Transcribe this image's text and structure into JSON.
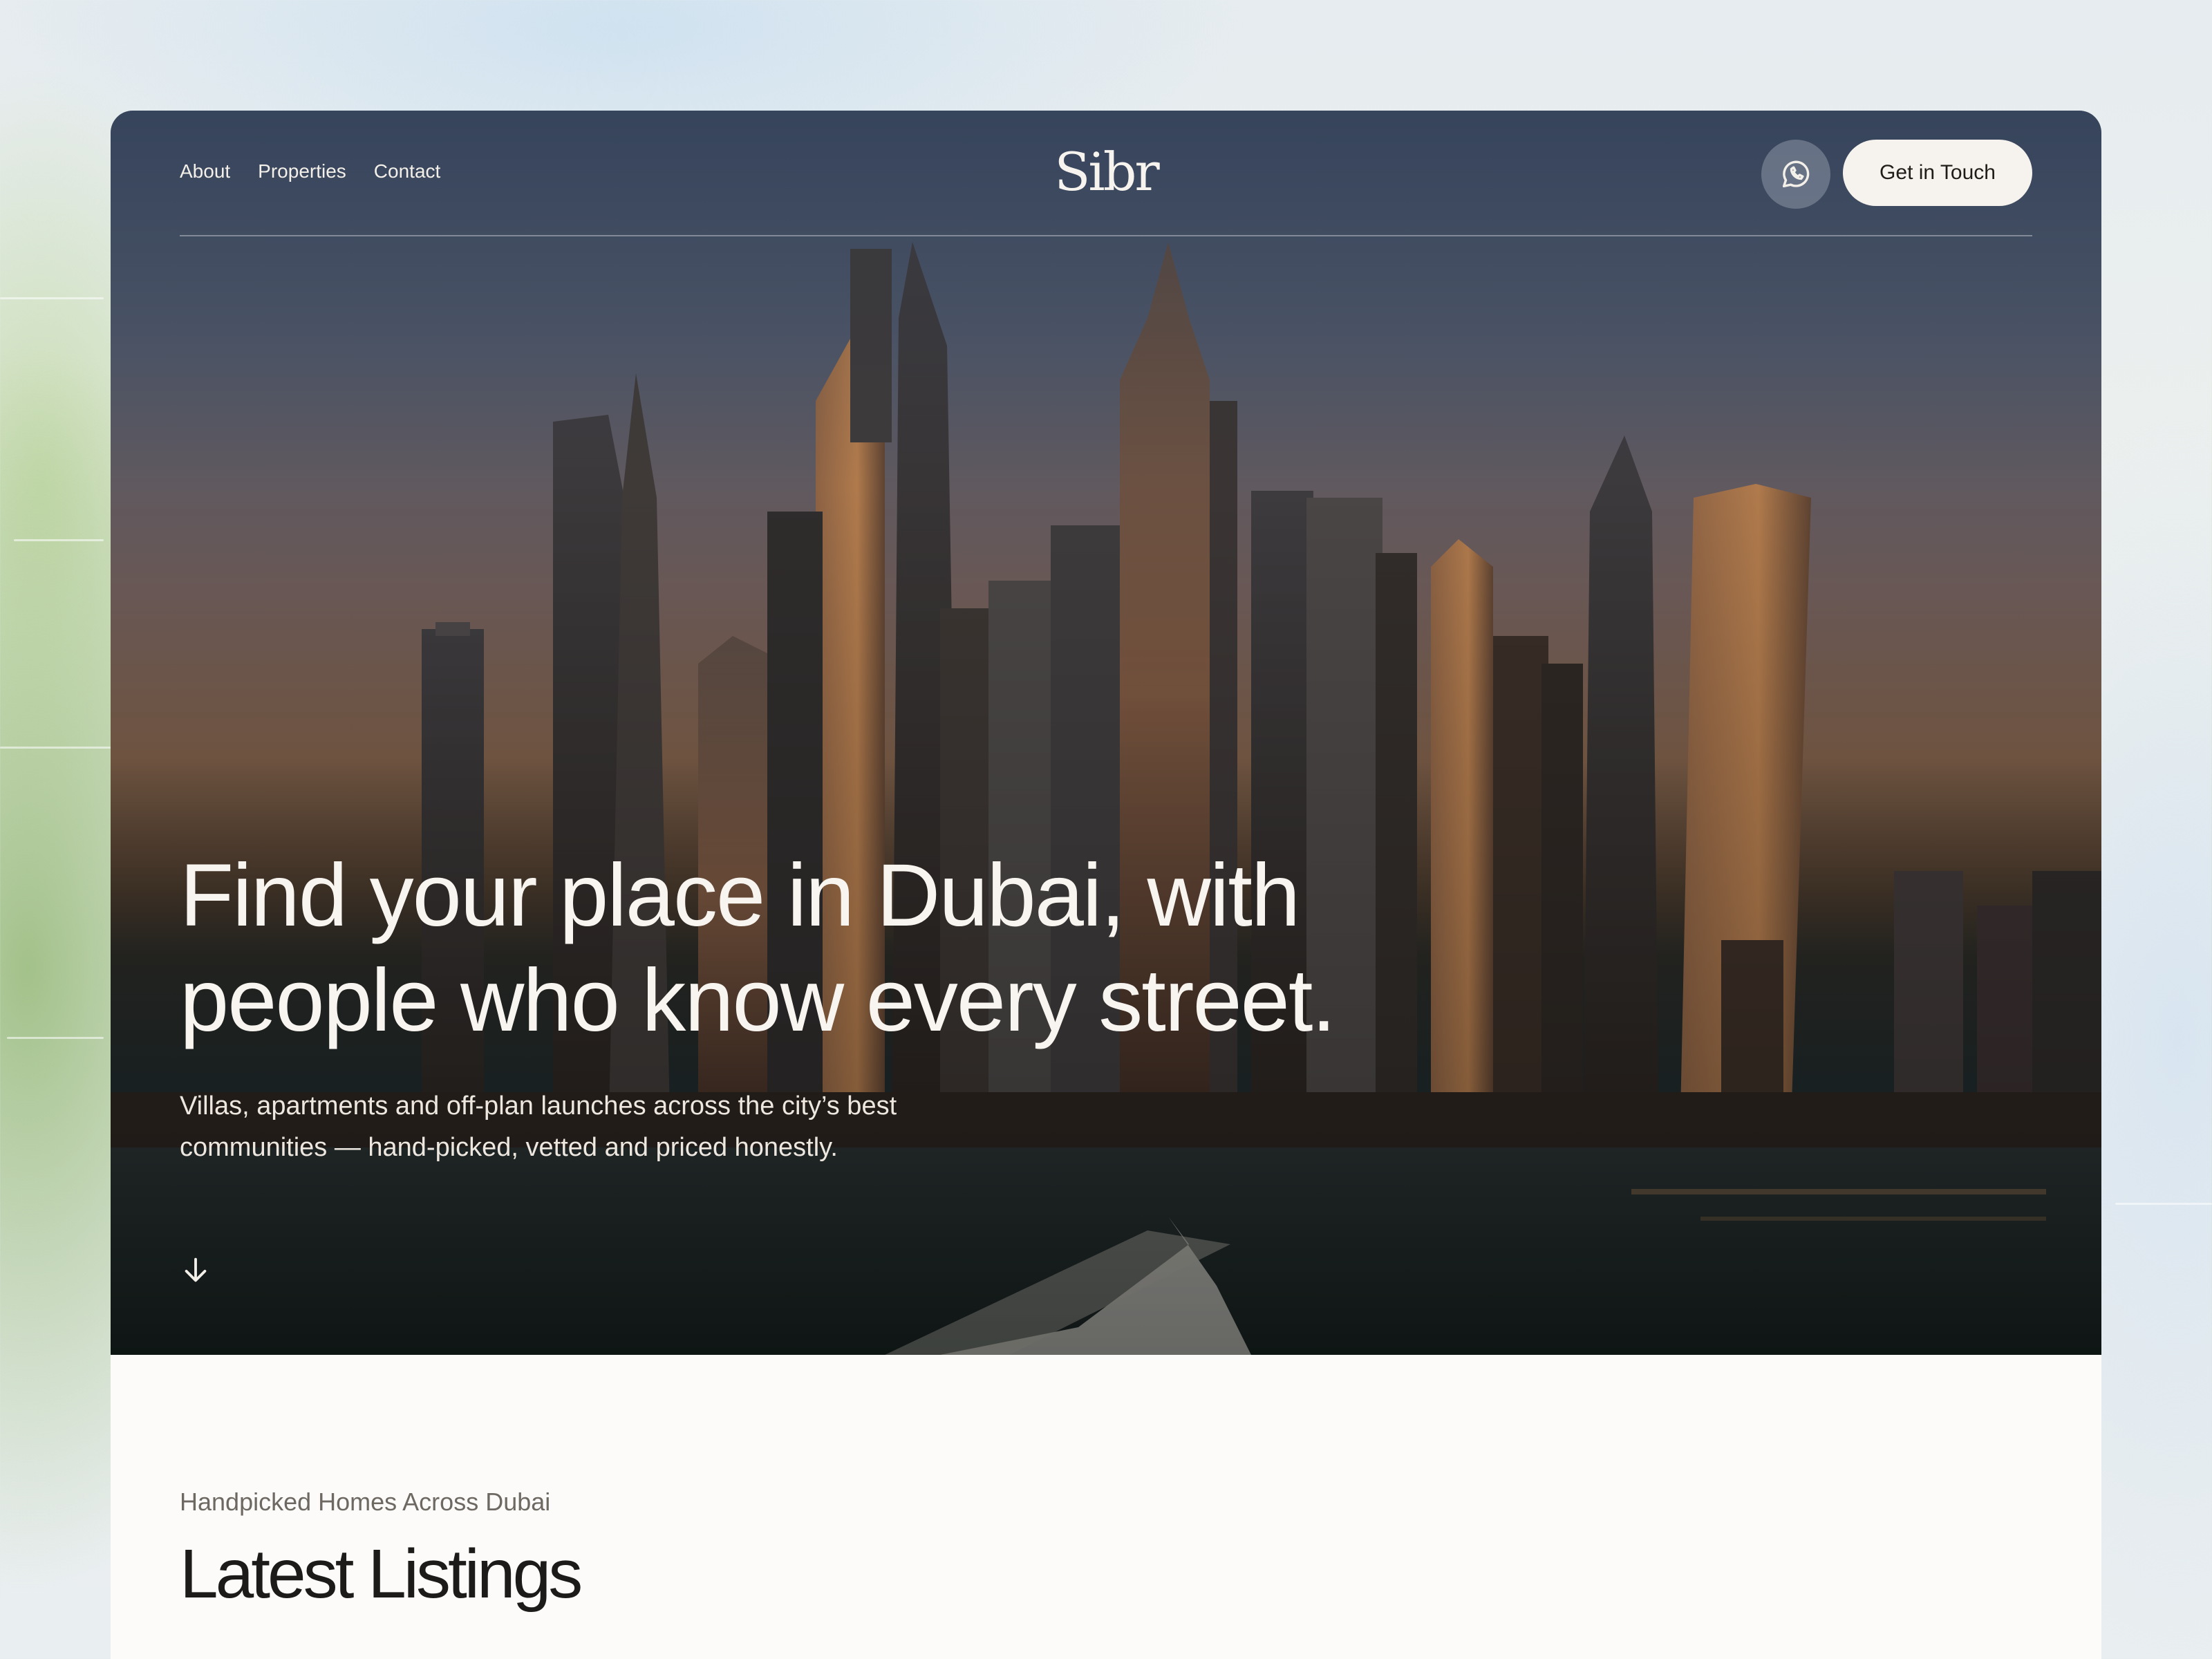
{
  "nav": {
    "links": [
      "About",
      "Properties",
      "Contact"
    ],
    "logo": "Sibr",
    "whatsapp_icon": "whatsapp-icon",
    "cta_label": "Get in Touch"
  },
  "hero": {
    "headline": "Find your place in Dubai, with people who know every street.",
    "subtitle": "Villas, apartments and off-plan launches across the city’s best communities — hand-picked, vetted and priced honestly.",
    "scroll_icon": "arrow-down-icon"
  },
  "listings": {
    "eyebrow": "Handpicked Homes Across Dubai",
    "title": "Latest Listings"
  },
  "colors": {
    "cta_background": "#f6f2ed",
    "card_background": "#fcfbf9",
    "heading_text": "#1c1b19"
  }
}
